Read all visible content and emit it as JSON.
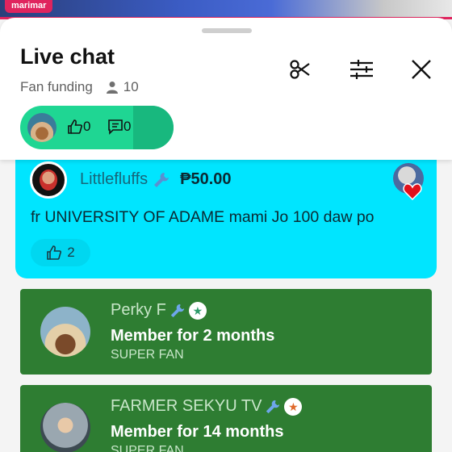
{
  "video": {
    "channel_tag": "marimar"
  },
  "header": {
    "title": "Live chat",
    "subtitle": "Fan funding",
    "viewer_count": "10",
    "icons": [
      "scissors-icon",
      "filter-sliders-icon",
      "close-icon"
    ]
  },
  "poll_pill": {
    "likes": "0",
    "comments": "0"
  },
  "superchat": {
    "author": "Littlefluffs",
    "amount": "₱50.00",
    "message": "fr UNIVERSITY OF ADAME mami Jo 100 daw po",
    "likes": "2",
    "color": "#00e5ff"
  },
  "members": [
    {
      "name": "Perky F",
      "line": "Member for 2 months",
      "level": "SUPER FAN",
      "badge_color": "#2e9b6b",
      "badge_glyph": "★"
    },
    {
      "name": "FARMER SEKYU TV",
      "line": "Member for 14 months",
      "level": "SUPER FAN",
      "badge_color": "#e0692a",
      "badge_glyph": "★"
    }
  ],
  "colors": {
    "member_bg": "#2e7d32",
    "accent_pink": "#e0245e",
    "pill_green": "#1fd693"
  }
}
